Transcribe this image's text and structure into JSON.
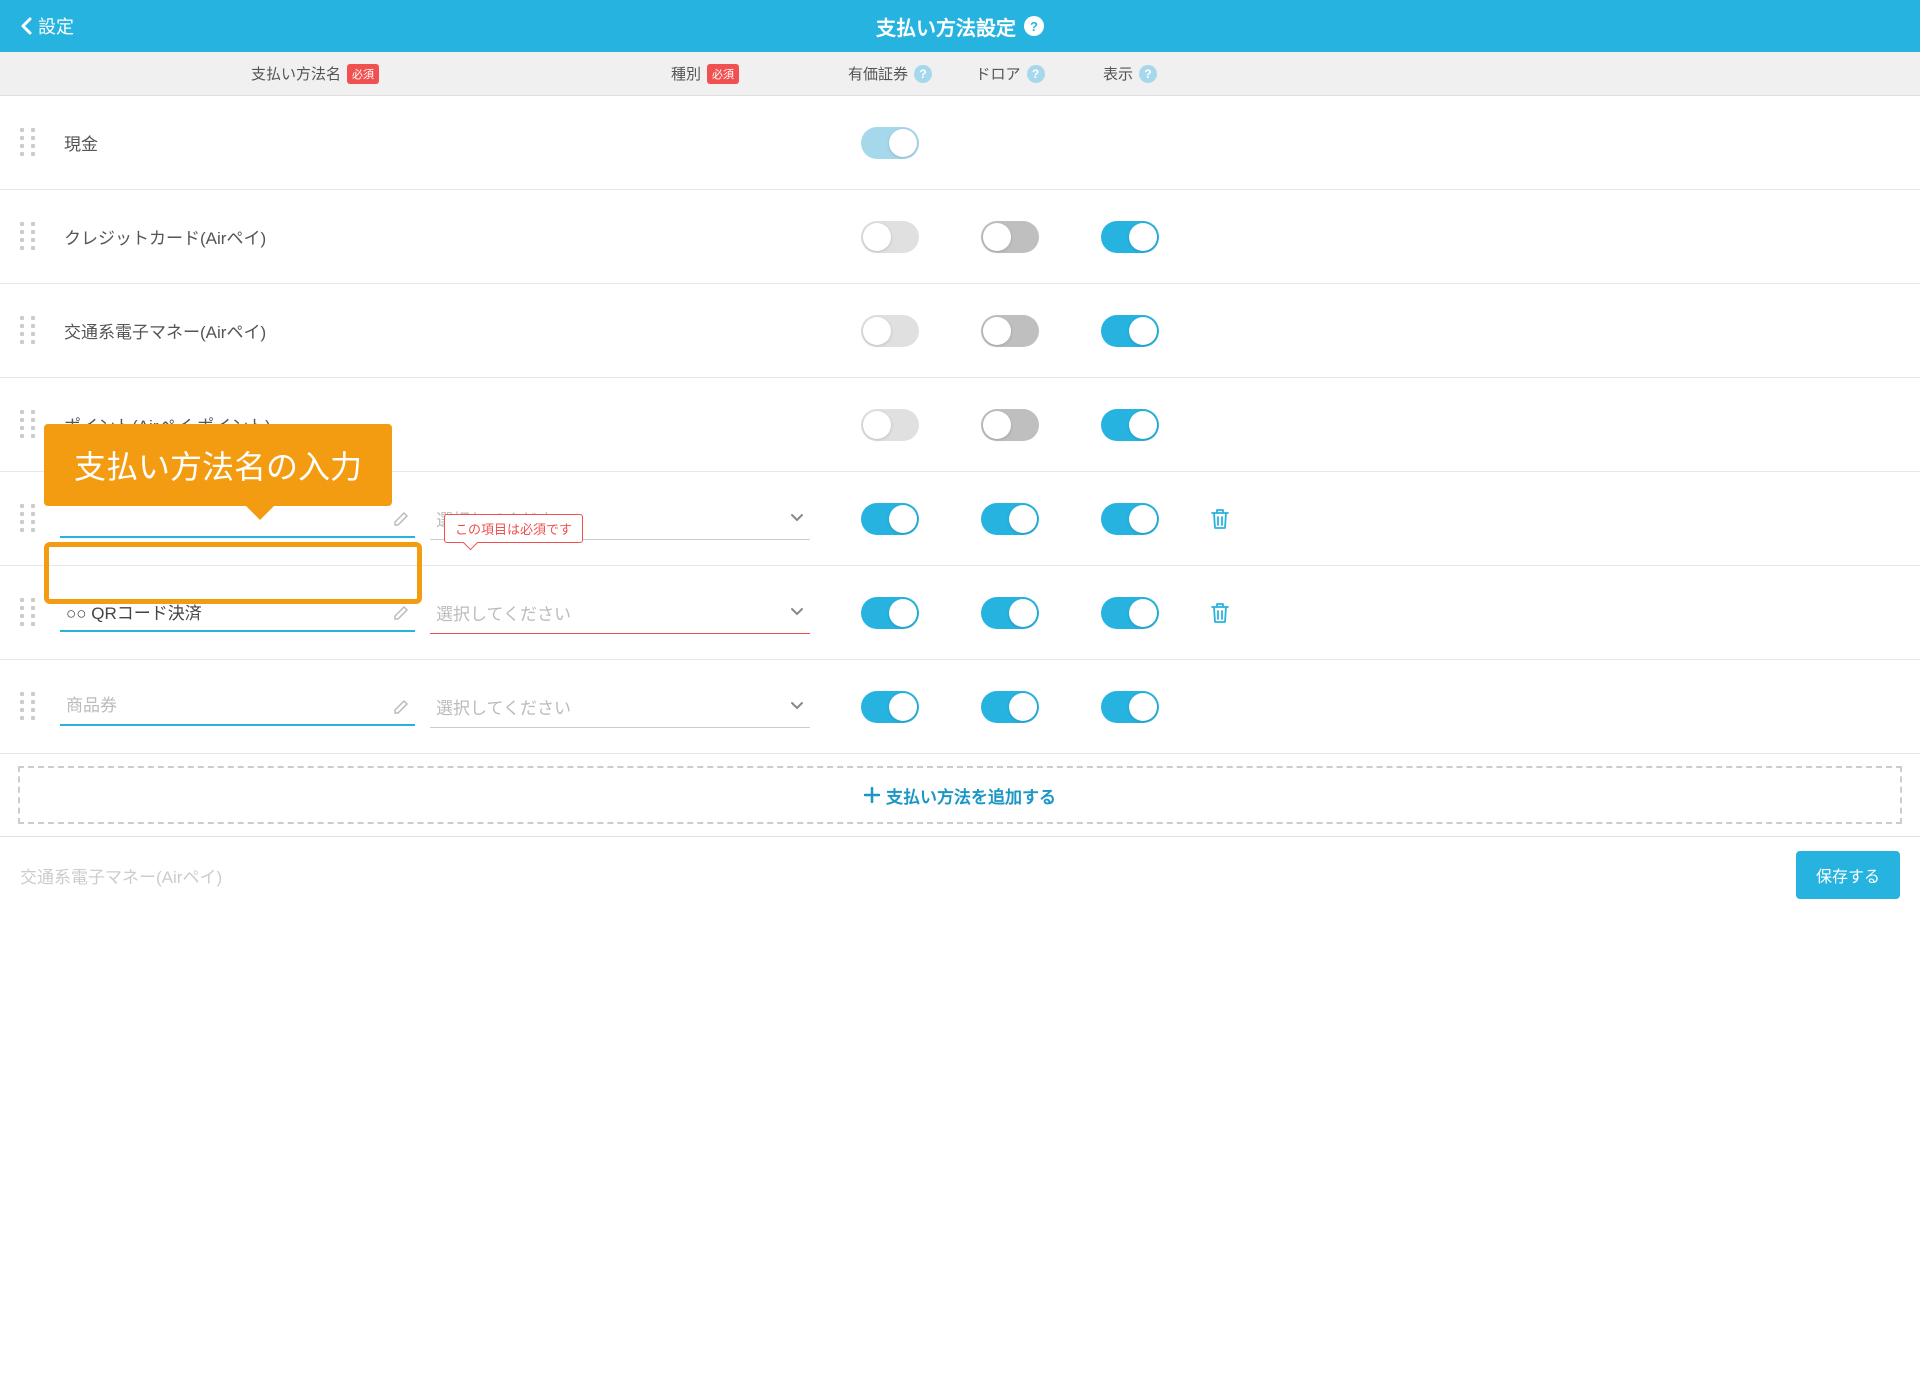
{
  "header": {
    "back_label": "設定",
    "title": "支払い方法設定"
  },
  "columns": {
    "name": "支払い方法名",
    "type": "種別",
    "security": "有価証券",
    "drawer": "ドロア",
    "display": "表示",
    "required": "必須"
  },
  "rows": [
    {
      "name": "現金",
      "editable": false,
      "security": "on-light",
      "drawer": null,
      "display": null,
      "deletable": false
    },
    {
      "name": "クレジットカード(Airペイ)",
      "editable": false,
      "security": "off",
      "drawer": "off-dark",
      "display": "on",
      "deletable": false
    },
    {
      "name": "交通系電子マネー(Airペイ)",
      "editable": false,
      "security": "off",
      "drawer": "off-dark",
      "display": "on",
      "deletable": false
    },
    {
      "name": "ポイント(Airペイ ポイント)",
      "editable": false,
      "security": "off",
      "drawer": "off-dark",
      "display": "on",
      "deletable": false
    },
    {
      "name": "",
      "editable": true,
      "type_value": "",
      "type_error": false,
      "has_type_select": true,
      "security": "on",
      "drawer": "on",
      "display": "on",
      "deletable": true
    },
    {
      "name": "○○ QRコード決済",
      "editable": true,
      "type_value": "",
      "type_placeholder": "選択してください",
      "type_error": true,
      "has_type_select": true,
      "security": "on",
      "drawer": "on",
      "display": "on",
      "deletable": true
    },
    {
      "name": "",
      "placeholder": "商品券",
      "editable": true,
      "type_value": "",
      "type_placeholder": "選択してください",
      "type_error": false,
      "has_type_select": true,
      "security": "on",
      "drawer": "on",
      "display": "on",
      "deletable": false
    }
  ],
  "type_placeholder": "選択してください",
  "error_tip": "この項目は必須です",
  "callout": "支払い方法名の入力",
  "add_button": "支払い方法を追加する",
  "footer_text": "交通系電子マネー(Airペイ)",
  "save_button": "保存する"
}
